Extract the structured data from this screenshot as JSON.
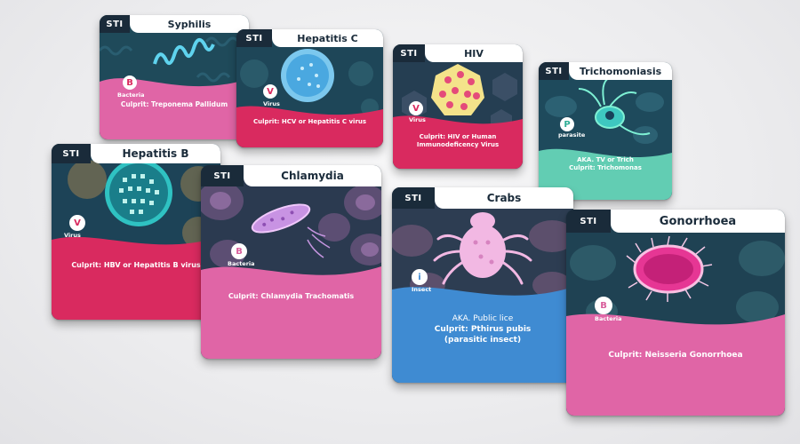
{
  "cards": {
    "syphilis": {
      "tag": "STI",
      "name": "Syphilis",
      "badge": "B",
      "type": "Bacteria",
      "culprit": "Culprit: Treponema Pallidum"
    },
    "hepatitis_c": {
      "tag": "STI",
      "name": "Hepatitis C",
      "badge": "V",
      "type": "Virus",
      "culprit": "Culprit: HCV or Hepatitis C virus"
    },
    "hiv": {
      "tag": "STI",
      "name": "HIV",
      "badge": "V",
      "type": "Virus",
      "culprit_line1": "Culprit: HIV or Human",
      "culprit_line2": "Immunodeficency Virus"
    },
    "trichomoniasis": {
      "tag": "STI",
      "name": "Trichomoniasis",
      "badge": "P",
      "type": "parasite",
      "aka": "AKA. TV or Trich",
      "culprit": "Culprit: Trichomonas"
    },
    "hepatitis_b": {
      "tag": "STI",
      "name": "Hepatitis B",
      "badge": "V",
      "type": "Virus",
      "culprit": "Culprit: HBV or Hepatitis B virus"
    },
    "chlamydia": {
      "tag": "STI",
      "name": "Chlamydia",
      "badge": "B",
      "type": "Bacteria",
      "culprit": "Culprit: Chlamydia Trachomatis"
    },
    "crabs": {
      "tag": "STI",
      "name": "Crabs",
      "badge": "i",
      "type": "Insect",
      "aka": "AKA. Public lice",
      "culprit_line1": "Culprit: Pthirus pubis",
      "culprit_line2": "(parasitic insect)"
    },
    "gonorrhoea": {
      "tag": "STI",
      "name": "Gonorrhoea",
      "badge": "B",
      "type": "Bacteria",
      "culprit": "Culprit: Neisseria Gonorrhoea"
    }
  },
  "colors": {
    "pink": "#e065a6",
    "magenta": "#d92a5f",
    "teal": "#62cdb3",
    "blue": "#3f8bd2",
    "navy": "#1f3f52"
  }
}
